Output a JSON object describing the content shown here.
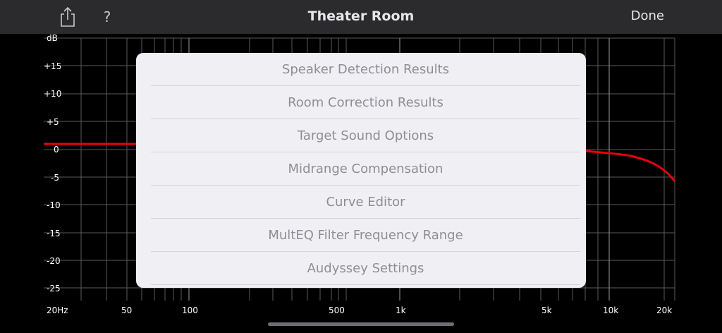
{
  "header": {
    "title": "Theater Room",
    "done_label": "Done",
    "help_label": "?",
    "share_icon": "share-icon"
  },
  "graph": {
    "y_unit_label": "dB",
    "y_tick_labels": [
      "+15",
      "+10",
      "+5",
      "0",
      "-5",
      "-10",
      "-15",
      "-20",
      "-25"
    ],
    "x_tick_labels": [
      "20Hz",
      "50",
      "100",
      "500",
      "1k",
      "5k",
      "10k",
      "20k"
    ],
    "curve_color": "#e8000b"
  },
  "menu": {
    "items": [
      {
        "label": "Speaker Detection Results"
      },
      {
        "label": "Room Correction Results"
      },
      {
        "label": "Target Sound Options"
      },
      {
        "label": "Midrange Compensation"
      },
      {
        "label": "Curve Editor"
      },
      {
        "label": "MultEQ Filter Frequency Range"
      },
      {
        "label": "Audyssey Settings"
      }
    ]
  }
}
